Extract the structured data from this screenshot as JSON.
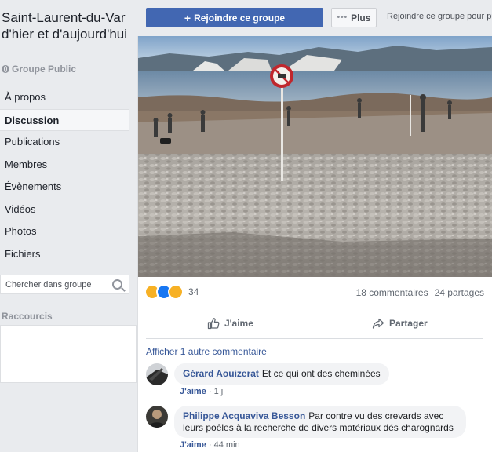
{
  "group": {
    "name": "Saint-Laurent-du-Var d'hier et d'aujourd'hui",
    "privacy": "Groupe Public"
  },
  "nav": {
    "items": [
      {
        "label": "À propos"
      },
      {
        "label": "Discussion"
      },
      {
        "label": "Publications"
      },
      {
        "label": "Membres"
      },
      {
        "label": "Évènements"
      },
      {
        "label": "Vidéos"
      },
      {
        "label": "Photos"
      },
      {
        "label": "Fichiers"
      }
    ],
    "active": "Discussion"
  },
  "search": {
    "placeholder": "Chercher dans groupe"
  },
  "shortcuts": {
    "title": "Raccourcis"
  },
  "topbar": {
    "join_label": "Rejoindre ce groupe",
    "more_label": "Plus",
    "hint": "Rejoindre ce groupe pour publier"
  },
  "post": {
    "reaction_count": "34",
    "comments_count": "18 commentaires",
    "shares_count": "24 partages",
    "like_label": "J'aime",
    "share_label": "Partager",
    "more_comments": "Afficher 1 autre commentaire"
  },
  "comments": [
    {
      "author": "Gérard Aouizerat",
      "text": "Et ce qui ont des cheminées",
      "like": "J'aime",
      "time": "1 j"
    },
    {
      "author": "Philippe Acquaviva Besson",
      "text": "Par contre vu des crevards avec leurs poêles à la recherche de divers matériaux dés charognards",
      "like": "J'aime",
      "time": "44 min"
    }
  ],
  "colors": {
    "brand": "#4267b2",
    "link": "#385898",
    "background": "#e9ebee"
  },
  "icons": [
    "globe-icon",
    "search-icon",
    "plus-icon",
    "dots-icon",
    "sad-reaction-icon",
    "like-reaction-icon",
    "wow-reaction-icon",
    "thumbs-up-icon",
    "share-arrow-icon"
  ]
}
